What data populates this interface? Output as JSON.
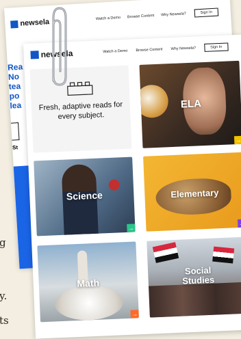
{
  "page_text_lines": [
    "g",
    "y.",
    "ts"
  ],
  "back_sheet": {
    "logo_text": "newsela",
    "nav": [
      "Watch a Demo",
      "Browse Content",
      "Why Newsela?"
    ],
    "sign_in": "Sign In",
    "hero_fragments": [
      "Rea",
      "No",
      "tea",
      "po",
      "lea"
    ],
    "side_label": "St"
  },
  "front_sheet": {
    "logo_text": "newsela",
    "nav": [
      "Watch a Demo",
      "Browse Content",
      "Why Newsela?"
    ],
    "sign_in": "Sign In",
    "intro_text": "Fresh, adaptive reads for every subject.",
    "tiles": [
      {
        "label": "ELA",
        "accent": "#f2c200"
      },
      {
        "label": "Science",
        "accent": "#2bc48a"
      },
      {
        "label": "Elementary",
        "accent": "#7b3fe4"
      },
      {
        "label": "Math",
        "accent": "#ff6a2a"
      },
      {
        "label": "Social Studies",
        "accent": "#e8294a"
      }
    ]
  },
  "colors": {
    "brand_blue": "#1256c6",
    "paper_bg": "#f3eee1"
  },
  "icons": [
    "newsela-logo-icon",
    "brick-icon",
    "arrow-icon",
    "paperclip-icon"
  ]
}
